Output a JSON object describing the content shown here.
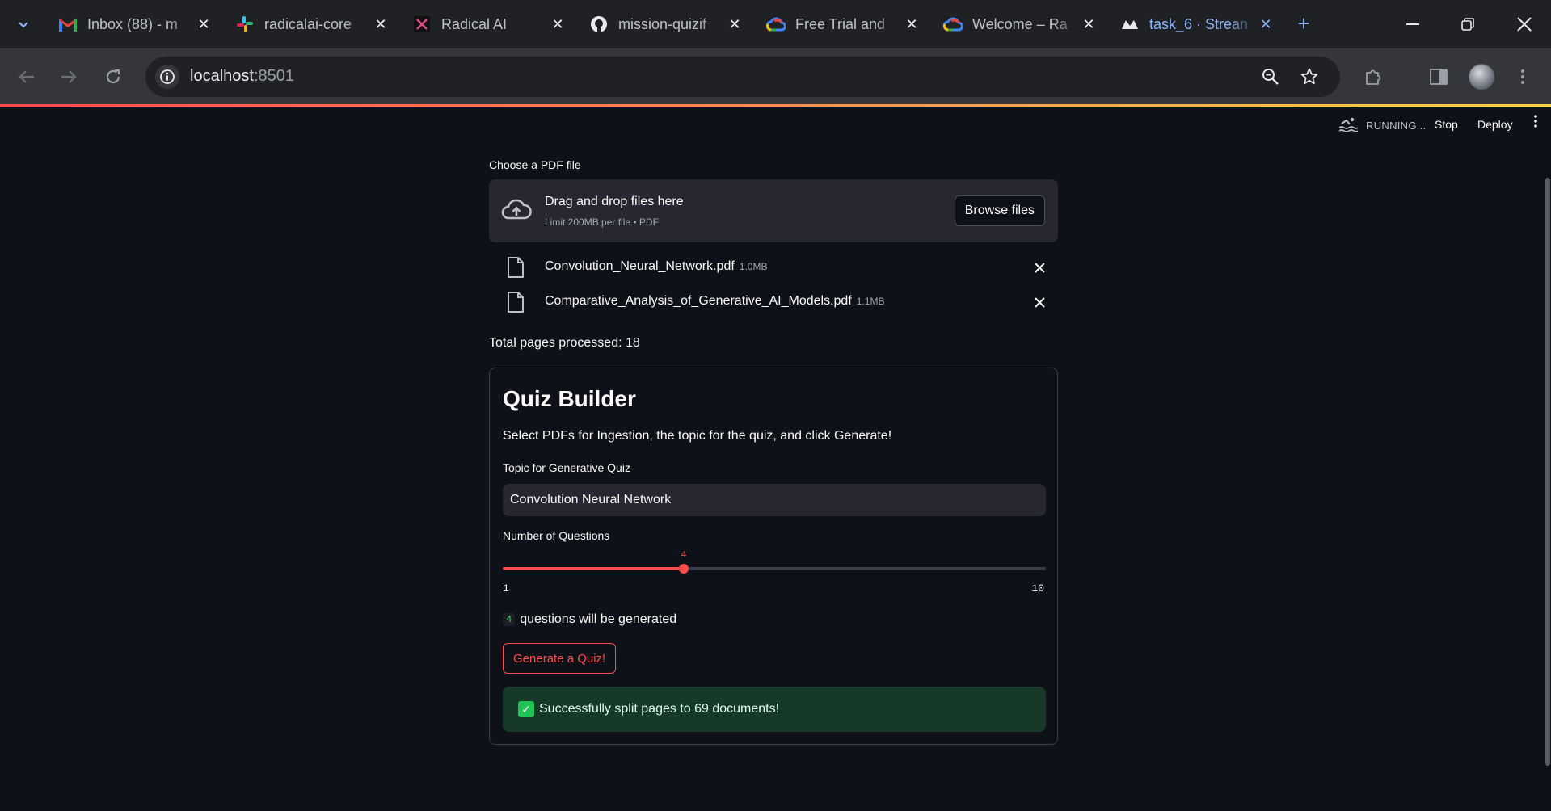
{
  "browser": {
    "tabs": [
      {
        "title": "Inbox (88) - m",
        "icon": "gmail-icon",
        "active": false
      },
      {
        "title": "radicalai-core",
        "icon": "slack-icon",
        "active": false
      },
      {
        "title": "Radical AI",
        "icon": "radical-ai-icon",
        "active": false
      },
      {
        "title": "mission-quizif",
        "icon": "github-icon",
        "active": false
      },
      {
        "title": "Free Trial and",
        "icon": "google-cloud-icon",
        "active": false
      },
      {
        "title": "Welcome – Ra",
        "icon": "google-cloud-icon",
        "active": false
      },
      {
        "title": "task_6 · Strean",
        "icon": "streamlit-icon",
        "active": true
      }
    ],
    "url_host": "localhost",
    "url_port": ":8501"
  },
  "app_header": {
    "status": "RUNNING...",
    "stop_label": "Stop",
    "deploy_label": "Deploy"
  },
  "uploader": {
    "label": "Choose a PDF file",
    "drop_title": "Drag and drop files here",
    "drop_subtitle": "Limit 200MB per file • PDF",
    "browse_label": "Browse files",
    "files": [
      {
        "name": "Convolution_Neural_Network.pdf",
        "size": "1.0MB"
      },
      {
        "name": "Comparative_Analysis_of_Generative_AI_Models.pdf",
        "size": "1.1MB"
      }
    ]
  },
  "pages_processed": "Total pages processed: 18",
  "quiz": {
    "title": "Quiz Builder",
    "description": "Select PDFs for Ingestion, the topic for the quiz, and click Generate!",
    "topic_label": "Topic for Generative Quiz",
    "topic_value": "Convolution Neural Network",
    "num_label": "Number of Questions",
    "slider_value": 4,
    "slider_min": 1,
    "slider_max": 10,
    "count_value": "4",
    "count_text": "questions will be generated",
    "generate_label": "Generate a Quiz!",
    "success_message": "Successfully split pages to 69 documents!"
  },
  "colors": {
    "accent": "#ff4b4b",
    "success_bg": "#173928",
    "background": "#0e1117"
  }
}
